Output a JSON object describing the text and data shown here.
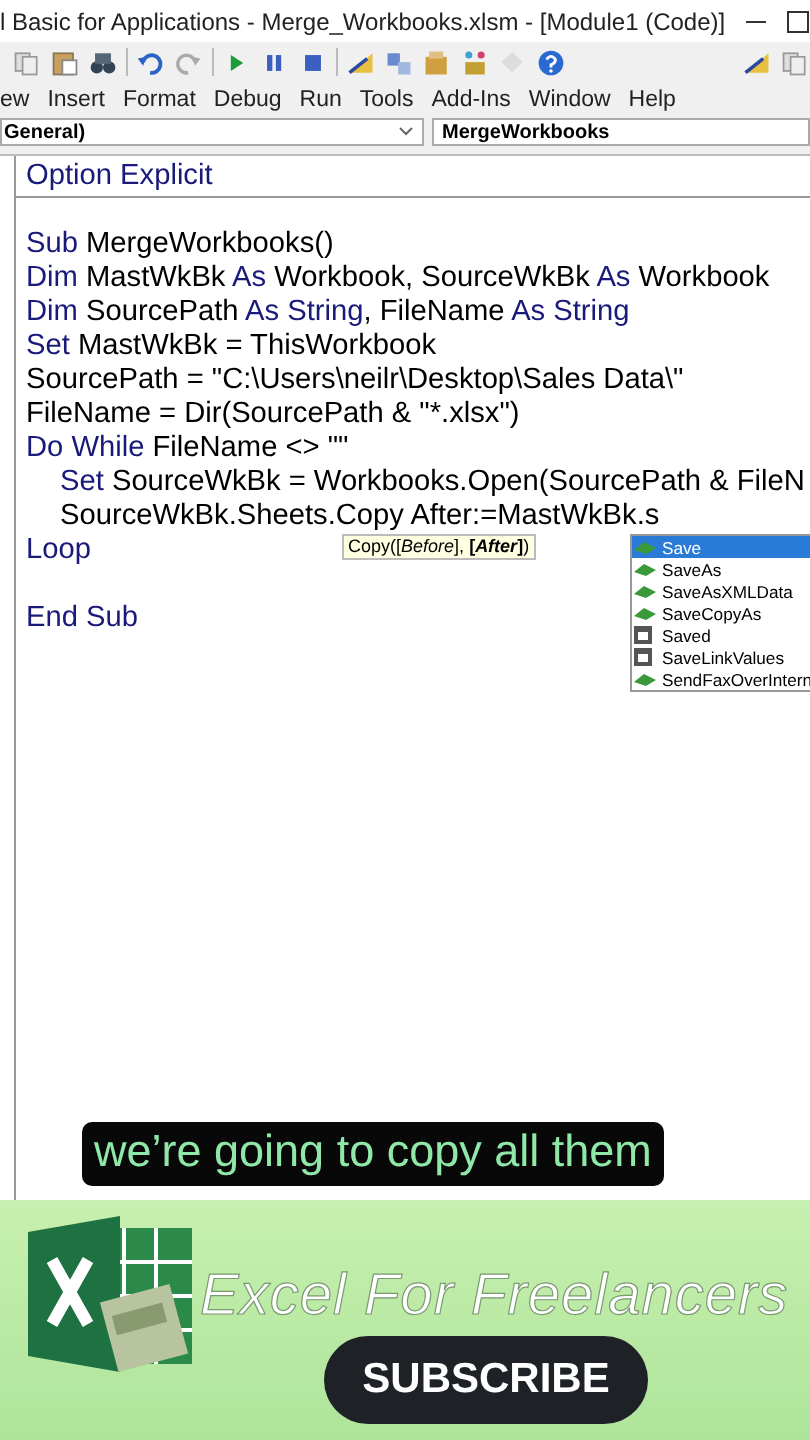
{
  "window": {
    "title": "l Basic for Applications - Merge_Workbooks.xlsm - [Module1 (Code)]"
  },
  "menu": [
    "ew",
    "Insert",
    "Format",
    "Debug",
    "Run",
    "Tools",
    "Add-Ins",
    "Window",
    "Help"
  ],
  "object_combo": {
    "value": "General)"
  },
  "procedure_combo": {
    "value": "MergeWorkbooks"
  },
  "declarations": [
    {
      "parts": [
        {
          "text": "Option Explicit",
          "kind": "keyword"
        }
      ]
    }
  ],
  "code_blocks": [
    [
      {
        "parts": [
          {
            "text": "Sub",
            "kind": "keyword"
          },
          {
            "text": " MergeWorkbooks()",
            "kind": "plain"
          }
        ]
      },
      {
        "parts": [
          {
            "text": "Dim",
            "kind": "keyword"
          },
          {
            "text": " MastWkBk ",
            "kind": "plain"
          },
          {
            "text": "As",
            "kind": "keyword"
          },
          {
            "text": " Workbook, SourceWkBk ",
            "kind": "plain"
          },
          {
            "text": "As",
            "kind": "keyword"
          },
          {
            "text": " Workbook",
            "kind": "plain"
          }
        ]
      },
      {
        "parts": [
          {
            "text": "Dim",
            "kind": "keyword"
          },
          {
            "text": " SourcePath ",
            "kind": "plain"
          },
          {
            "text": "As String",
            "kind": "keyword"
          },
          {
            "text": ", FileName ",
            "kind": "plain"
          },
          {
            "text": "As String",
            "kind": "keyword"
          }
        ]
      },
      {
        "parts": [
          {
            "text": "Set",
            "kind": "keyword"
          },
          {
            "text": " MastWkBk = ThisWorkbook",
            "kind": "plain"
          }
        ]
      },
      {
        "parts": [
          {
            "text": "SourcePath = \"C:\\Users\\neilr\\Desktop\\Sales Data\\\"",
            "kind": "plain"
          }
        ]
      },
      {
        "parts": [
          {
            "text": "FileName = Dir(SourcePath & \"*.xlsx\")",
            "kind": "plain"
          }
        ]
      },
      {
        "parts": [
          {
            "text": "Do While",
            "kind": "keyword"
          },
          {
            "text": " FileName <> \"\"",
            "kind": "plain"
          }
        ],
        "children": [
          {
            "parts": [
              {
                "text": "Set",
                "kind": "keyword"
              },
              {
                "text": " SourceWkBk = Workbooks.Open(SourcePath & FileN",
                "kind": "plain"
              }
            ]
          },
          {
            "parts": [
              {
                "text": "SourceWkBk.Sheets.Copy After:=MastWkBk.s",
                "kind": "plain"
              }
            ]
          }
        ]
      },
      {
        "parts": [
          {
            "text": "Loop",
            "kind": "keyword"
          }
        ]
      }
    ],
    [
      {
        "parts": [
          {
            "text": "End Sub",
            "kind": "keyword"
          }
        ]
      }
    ]
  ],
  "tooltip": "Copy([*Before*], **[*After*]**)",
  "autocomplete": [
    {
      "label": "Save",
      "kind": "method",
      "selected": true
    },
    {
      "label": "SaveAs",
      "kind": "method",
      "selected": false
    },
    {
      "label": "SaveAsXMLData",
      "kind": "method",
      "selected": false
    },
    {
      "label": "SaveCopyAs",
      "kind": "method",
      "selected": false
    },
    {
      "label": "Saved",
      "kind": "property",
      "selected": false
    },
    {
      "label": "SaveLinkValues",
      "kind": "property",
      "selected": false
    },
    {
      "label": "SendFaxOverIntern",
      "kind": "method",
      "selected": false
    }
  ],
  "caption": "we’re going to copy all them",
  "banner": {
    "brand": "Excel For Freelancers",
    "button": "SUBSCRIBE"
  }
}
